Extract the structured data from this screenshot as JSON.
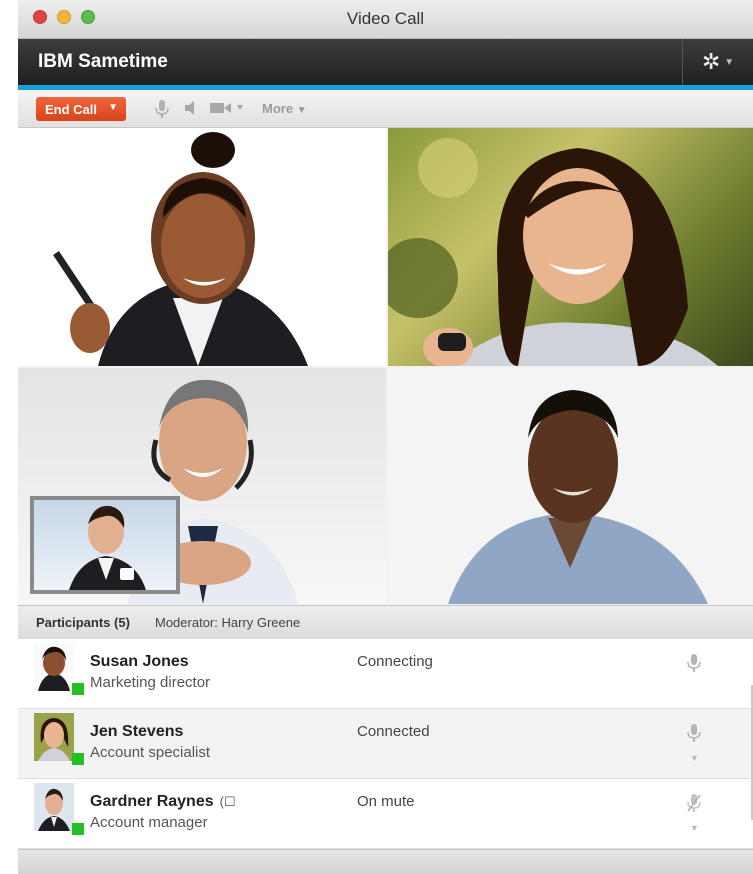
{
  "window": {
    "title": "Video Call"
  },
  "app": {
    "title": "IBM Sametime"
  },
  "toolbar": {
    "end_call_label": "End Call",
    "more_label": "More"
  },
  "participants": {
    "header_label": "Participants (5)",
    "moderator_text": "Moderator: Harry Greene",
    "items": [
      {
        "name": "Susan Jones",
        "role": "Marketing director",
        "status": "Connecting"
      },
      {
        "name": "Jen Stevens",
        "role": "Account specialist",
        "status": "Connected"
      },
      {
        "name": "Gardner Raynes",
        "role": "Account manager",
        "status": "On mute"
      }
    ]
  },
  "icons": {
    "settings": "gear-icon",
    "microphone": "microphone-icon",
    "speaker": "speaker-icon",
    "video": "video-camera-icon",
    "muted_microphone": "microphone-muted-icon"
  },
  "colors": {
    "accent": "#1aa0d8",
    "end_call": "#e4522a",
    "presence_online": "#22c022",
    "header_bar": "#2a2a2a"
  }
}
